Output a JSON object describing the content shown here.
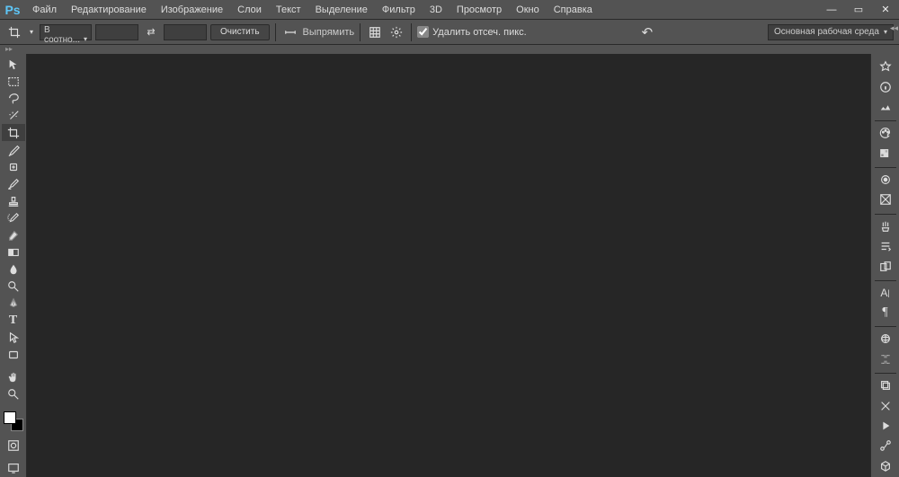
{
  "app_logo": "Ps",
  "menu": [
    "Файл",
    "Редактирование",
    "Изображение",
    "Слои",
    "Текст",
    "Выделение",
    "Фильтр",
    "3D",
    "Просмотр",
    "Окно",
    "Справка"
  ],
  "win_controls": {
    "min": "—",
    "max": "▭",
    "close": "✕"
  },
  "options": {
    "ratio_select": "В соотно...",
    "clear_btn": "Очистить",
    "straighten": "Выпрямить",
    "delete_cropped": "Удалить отсеч. пикс."
  },
  "workspace_select": "Основная рабочая среда",
  "expand_marker": "▸▸",
  "collapse_marker": "◂◂",
  "tools": [
    {
      "name": "move-tool",
      "glyph": "↖"
    },
    {
      "name": "marquee-tool",
      "glyph": "▭"
    },
    {
      "name": "lasso-tool",
      "glyph": "◉"
    },
    {
      "name": "wand-tool",
      "glyph": "✦"
    },
    {
      "name": "crop-tool",
      "glyph": "✂",
      "active": true
    },
    {
      "name": "eyedropper-tool",
      "glyph": "✎"
    },
    {
      "name": "spot-heal-tool",
      "glyph": "✜"
    },
    {
      "name": "brush-tool",
      "glyph": "🖌"
    },
    {
      "name": "stamp-tool",
      "glyph": "▲"
    },
    {
      "name": "history-brush-tool",
      "glyph": "↺"
    },
    {
      "name": "eraser-tool",
      "glyph": "◧"
    },
    {
      "name": "gradient-tool",
      "glyph": "◐"
    },
    {
      "name": "blur-tool",
      "glyph": "💧"
    },
    {
      "name": "dodge-tool",
      "glyph": "🔍"
    },
    {
      "name": "pen-tool",
      "glyph": "✒"
    },
    {
      "name": "type-tool",
      "glyph": "T"
    },
    {
      "name": "path-select-tool",
      "glyph": "▷"
    },
    {
      "name": "shape-tool",
      "glyph": "▭"
    }
  ],
  "tools2": [
    {
      "name": "hand-tool",
      "glyph": "✋"
    },
    {
      "name": "zoom-tool",
      "glyph": "🔍"
    }
  ],
  "quickmask": "◩",
  "screenmode": "▣",
  "right_panels": [
    {
      "name": "histogram-panel",
      "glyph": "✷"
    },
    {
      "name": "info-panel",
      "glyph": "ⓘ"
    },
    {
      "name": "navigator-panel",
      "glyph": "≋"
    },
    {
      "sep": true
    },
    {
      "name": "color-panel",
      "glyph": "🎨"
    },
    {
      "name": "swatches-panel",
      "glyph": "▦"
    },
    {
      "sep": true
    },
    {
      "name": "styles-panel",
      "glyph": "◎"
    },
    {
      "name": "adjustments-panel",
      "glyph": "◪"
    },
    {
      "sep": true
    },
    {
      "name": "brush-panel",
      "glyph": "Ψ"
    },
    {
      "name": "brush-presets-panel",
      "glyph": "≡"
    },
    {
      "name": "clone-source-panel",
      "glyph": "◫"
    },
    {
      "sep": true
    },
    {
      "name": "character-panel",
      "glyph": "A|"
    },
    {
      "name": "paragraph-panel",
      "glyph": "¶"
    },
    {
      "sep": true
    },
    {
      "name": "3d-panel",
      "glyph": "◉"
    },
    {
      "name": "timeline-panel",
      "glyph": "⧈"
    },
    {
      "sep": true
    },
    {
      "name": "layers-panel",
      "glyph": "❐"
    },
    {
      "name": "tools-preset-panel",
      "glyph": "✕"
    },
    {
      "name": "actions-panel",
      "glyph": "▶"
    },
    {
      "name": "paths-panel",
      "glyph": "◇"
    },
    {
      "name": "3d-cube-panel",
      "glyph": "⬚"
    }
  ]
}
